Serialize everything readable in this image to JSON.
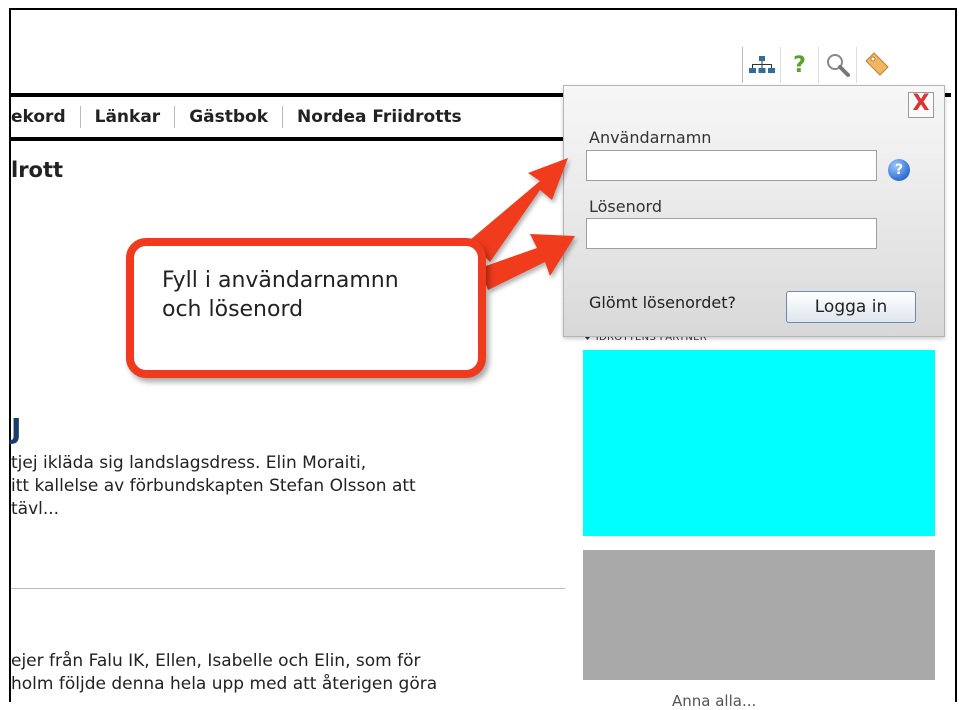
{
  "nav": {
    "items": [
      "ekord",
      "Länkar",
      "Gästbok",
      "Nordea Friidrotts"
    ]
  },
  "main": {
    "heading": "lrott",
    "big_letter": "J",
    "article1": [
      "tjej ikläda sig landslagsdress. Elin Moraiti,",
      "itt kallelse av förbundskapten Stefan Olsson att",
      " tävl..."
    ],
    "article2": [
      "ejer från Falu IK, Ellen, Isabelle och Elin, som för",
      "holm följde denna hela upp med att återigen göra"
    ]
  },
  "toolbar": {
    "icons": [
      "sitemap-icon",
      "help-icon",
      "search-icon",
      "tag-icon"
    ]
  },
  "login": {
    "close_label": "X",
    "username_label": "Användarnamn",
    "password_label": "Lösenord",
    "username_value": "",
    "password_value": "",
    "help_label": "?",
    "forgot_label": "Glömt lösenordet?",
    "submit_label": "Logga in"
  },
  "sidebar": {
    "partner_label": "♥ IDROTTENS PARTNER",
    "bottom_link": "Anna alla..."
  },
  "callout": {
    "text": "Fyll i användarnamnn\noch lösenord"
  },
  "colors": {
    "callout_border": "#f03a1e",
    "ad_top": "#00ffff",
    "ad_bottom": "#a9a9a9"
  }
}
